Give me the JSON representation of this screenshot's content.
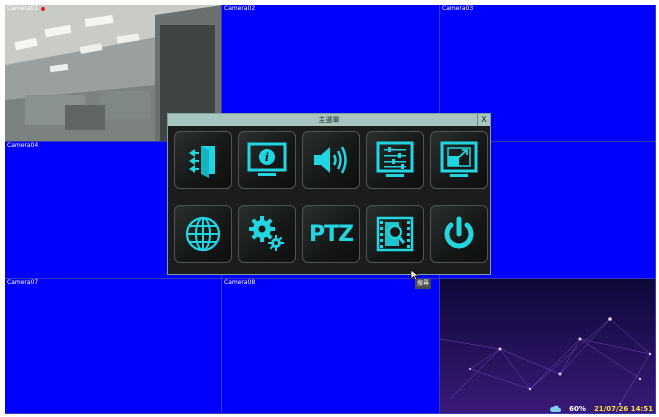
{
  "cameras": [
    {
      "label": "Camera01"
    },
    {
      "label": "Camera02"
    },
    {
      "label": "Camera03"
    },
    {
      "label": "Camera04"
    },
    {
      "label": ""
    },
    {
      "label": ""
    },
    {
      "label": "Camera07"
    },
    {
      "label": "Camera08"
    },
    {
      "label": ""
    }
  ],
  "menu": {
    "title": "主選單",
    "close_label": "X",
    "items": [
      {
        "name": "exit-icon",
        "label": ""
      },
      {
        "name": "info-icon",
        "label": ""
      },
      {
        "name": "volume-icon",
        "label": ""
      },
      {
        "name": "adjust-icon",
        "label": ""
      },
      {
        "name": "display-icon",
        "label": ""
      },
      {
        "name": "network-icon",
        "label": ""
      },
      {
        "name": "settings-icon",
        "label": ""
      },
      {
        "name": "ptz-icon",
        "label": "PTZ"
      },
      {
        "name": "search-video-icon",
        "label": ""
      },
      {
        "name": "power-icon",
        "label": ""
      }
    ]
  },
  "tooltip": "搜尋",
  "status": {
    "percent": "60%",
    "datetime": "21/07/26 14:51"
  },
  "colors": {
    "accent": "#21d6e0",
    "cell_bg": "#0000ff",
    "title_bar": "#a7c6c0"
  }
}
